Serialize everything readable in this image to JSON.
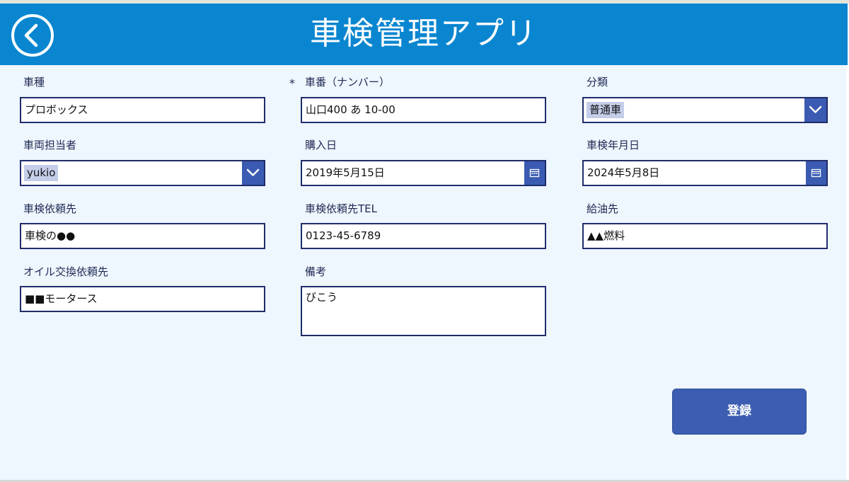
{
  "header": {
    "title": "車検管理アプリ",
    "back_icon": "chevron-left-circle-icon",
    "background": "#0a86d0"
  },
  "form": {
    "required_mark": "*",
    "fields": {
      "car_model": {
        "label": "車種",
        "value": "プロボックス"
      },
      "plate_number": {
        "label": "車番（ナンバー）",
        "value": "山口400 あ 10-00",
        "required": true
      },
      "category": {
        "label": "分類",
        "value": "普通車",
        "control": "dropdown"
      },
      "vehicle_manager": {
        "label": "車両担当者",
        "value": "yukio",
        "control": "dropdown"
      },
      "purchase_date": {
        "label": "購入日",
        "value": "2019年5月15日",
        "control": "date-picker"
      },
      "inspection_date": {
        "label": "車検年月日",
        "value": "2024年5月8日",
        "control": "date-picker"
      },
      "inspection_vendor": {
        "label": "車検依頼先",
        "value": "車検の●●"
      },
      "inspection_vendor_tel": {
        "label": "車検依頼先TEL",
        "value": "0123-45-6789"
      },
      "fuel_supplier": {
        "label": "給油先",
        "value": "▲▲燃料"
      },
      "oil_change_vendor": {
        "label": "オイル交換依頼先",
        "value": "■■モータース"
      },
      "notes": {
        "label": "備考",
        "value": "びこう",
        "control": "multiline"
      }
    }
  },
  "actions": {
    "register_label": "登録"
  },
  "colors": {
    "form_background": "#eef6fe",
    "field_border": "#1f2d6b",
    "accent_button": "#3b5eb2",
    "selected_highlight": "#c4cee9"
  }
}
